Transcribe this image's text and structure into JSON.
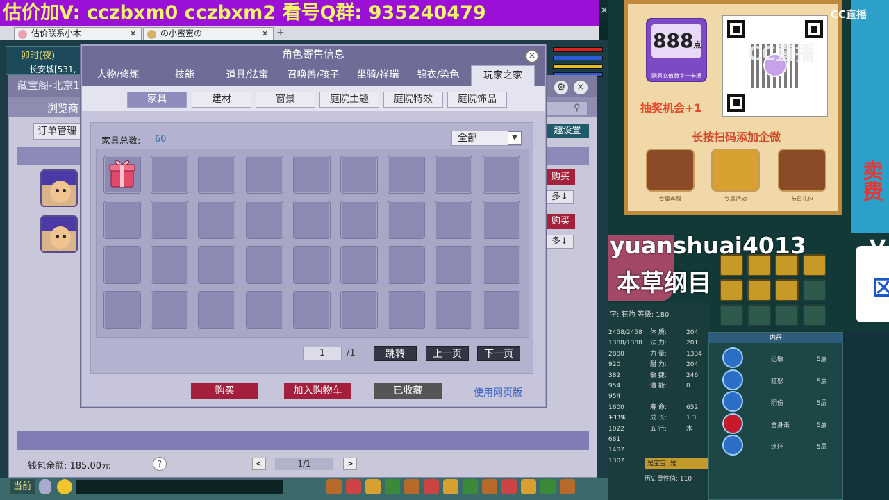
{
  "banner": {
    "text": "估价加V:  cczbxm0   cczbxm2   看号Q群: 935240479",
    "close": "×"
  },
  "browser_tabs": [
    {
      "label": "估价联系小木",
      "close": "×"
    },
    {
      "label": "の小蜜蜜の",
      "close": "×"
    }
  ],
  "add_tab": "+",
  "game": {
    "time": "卯时(夜)",
    "city": "长安城[531,",
    "zbg_title": "藏宝阁-北京1",
    "browse": "浏览商",
    "order_mgmt": "订单管理",
    "interest_settings": "趣设置",
    "buy_small": "购买",
    "more_small": "多↓",
    "wallet": "钱包余额: 185.00元",
    "help": "?",
    "pager": {
      "prev": "<",
      "page": "1/1",
      "next": ">"
    },
    "chat_label": "当前"
  },
  "dialog": {
    "title": "角色寄售信息",
    "close": "×",
    "tabs": [
      "人物/修炼",
      "技能",
      "道具/法宝",
      "召唤兽/孩子",
      "坐骑/祥瑞",
      "锦衣/染色",
      "玩家之家"
    ],
    "active_tab": 6,
    "subtabs": [
      "家具",
      "建材",
      "窗景",
      "庭院主题",
      "庭院特效",
      "庭院饰品"
    ],
    "active_subtab": 0,
    "count_label": "家具总数:",
    "count_value": "60",
    "filter_value": "全部",
    "filter_arrow": "▼",
    "grid": {
      "rows": 4,
      "cols": 9,
      "filled_slots": [
        0
      ],
      "first_item_icon": "gift-box-icon"
    },
    "page_input": "1",
    "page_total": "/1",
    "jump": "跳转",
    "prev_page": "上一页",
    "next_page": "下一页",
    "buy": "购买",
    "add_cart": "加入购物车",
    "collected": "已收藏",
    "web_version": "使用网页版"
  },
  "promo": {
    "card_number": "888",
    "card_unit": "点",
    "card_sub": "网易充值数字一卡通",
    "lottery": "抽奖机会+1",
    "scan_text": "长按扫码添加企微",
    "icons": [
      {
        "label": "专属客服"
      },
      {
        "label": "专属活动"
      },
      {
        "label": "节日礼包"
      }
    ],
    "cc_logo": "CC直播",
    "watermark": "CC直播"
  },
  "side": {
    "red_text": "卖费",
    "v_text": "V",
    "white_text": "区"
  },
  "stream": {
    "username": "yuanshuai4013",
    "overlay": "本草纲目"
  },
  "pet": {
    "name_line": "字: 狂豹  等级: 180",
    "stats": [
      {
        "a": "2458/2458",
        "b": "体  质:",
        "c": "204"
      },
      {
        "a": "1388/1388",
        "b": "法  力:",
        "c": "201"
      },
      {
        "a": "2880",
        "b": "力  量:",
        "c": "1334"
      },
      {
        "a": "920",
        "b": "耐  力:",
        "c": "204"
      },
      {
        "a": "382",
        "b": "敏  捷:",
        "c": "246"
      },
      {
        "a": "954",
        "b": "潜  能:",
        "c": "0"
      },
      {
        "a": "954",
        "b": "",
        "c": ""
      },
      {
        "a": "1600 +114",
        "b": "寿  命:",
        "c": "652"
      },
      {
        "a": "1339",
        "b": "成  长:",
        "c": "1.3"
      },
      {
        "a": "1022",
        "b": "五  行:",
        "c": "木"
      },
      {
        "a": "681",
        "b": "",
        "c": ""
      },
      {
        "a": "1407",
        "b": "",
        "c": ""
      },
      {
        "a": "1307",
        "b": "",
        "c": ""
      }
    ],
    "highlight": "是宝宝: 是",
    "history": "历史灵性值: 110"
  },
  "neidan": {
    "head": "内丹",
    "items": [
      {
        "name": "迅敏",
        "level": "5层"
      },
      {
        "name": "狂怒",
        "level": "5层"
      },
      {
        "name": "阴伤",
        "level": "5层"
      },
      {
        "name": "舍身击",
        "level": "5层"
      },
      {
        "name": "连环",
        "level": "5层"
      }
    ]
  }
}
